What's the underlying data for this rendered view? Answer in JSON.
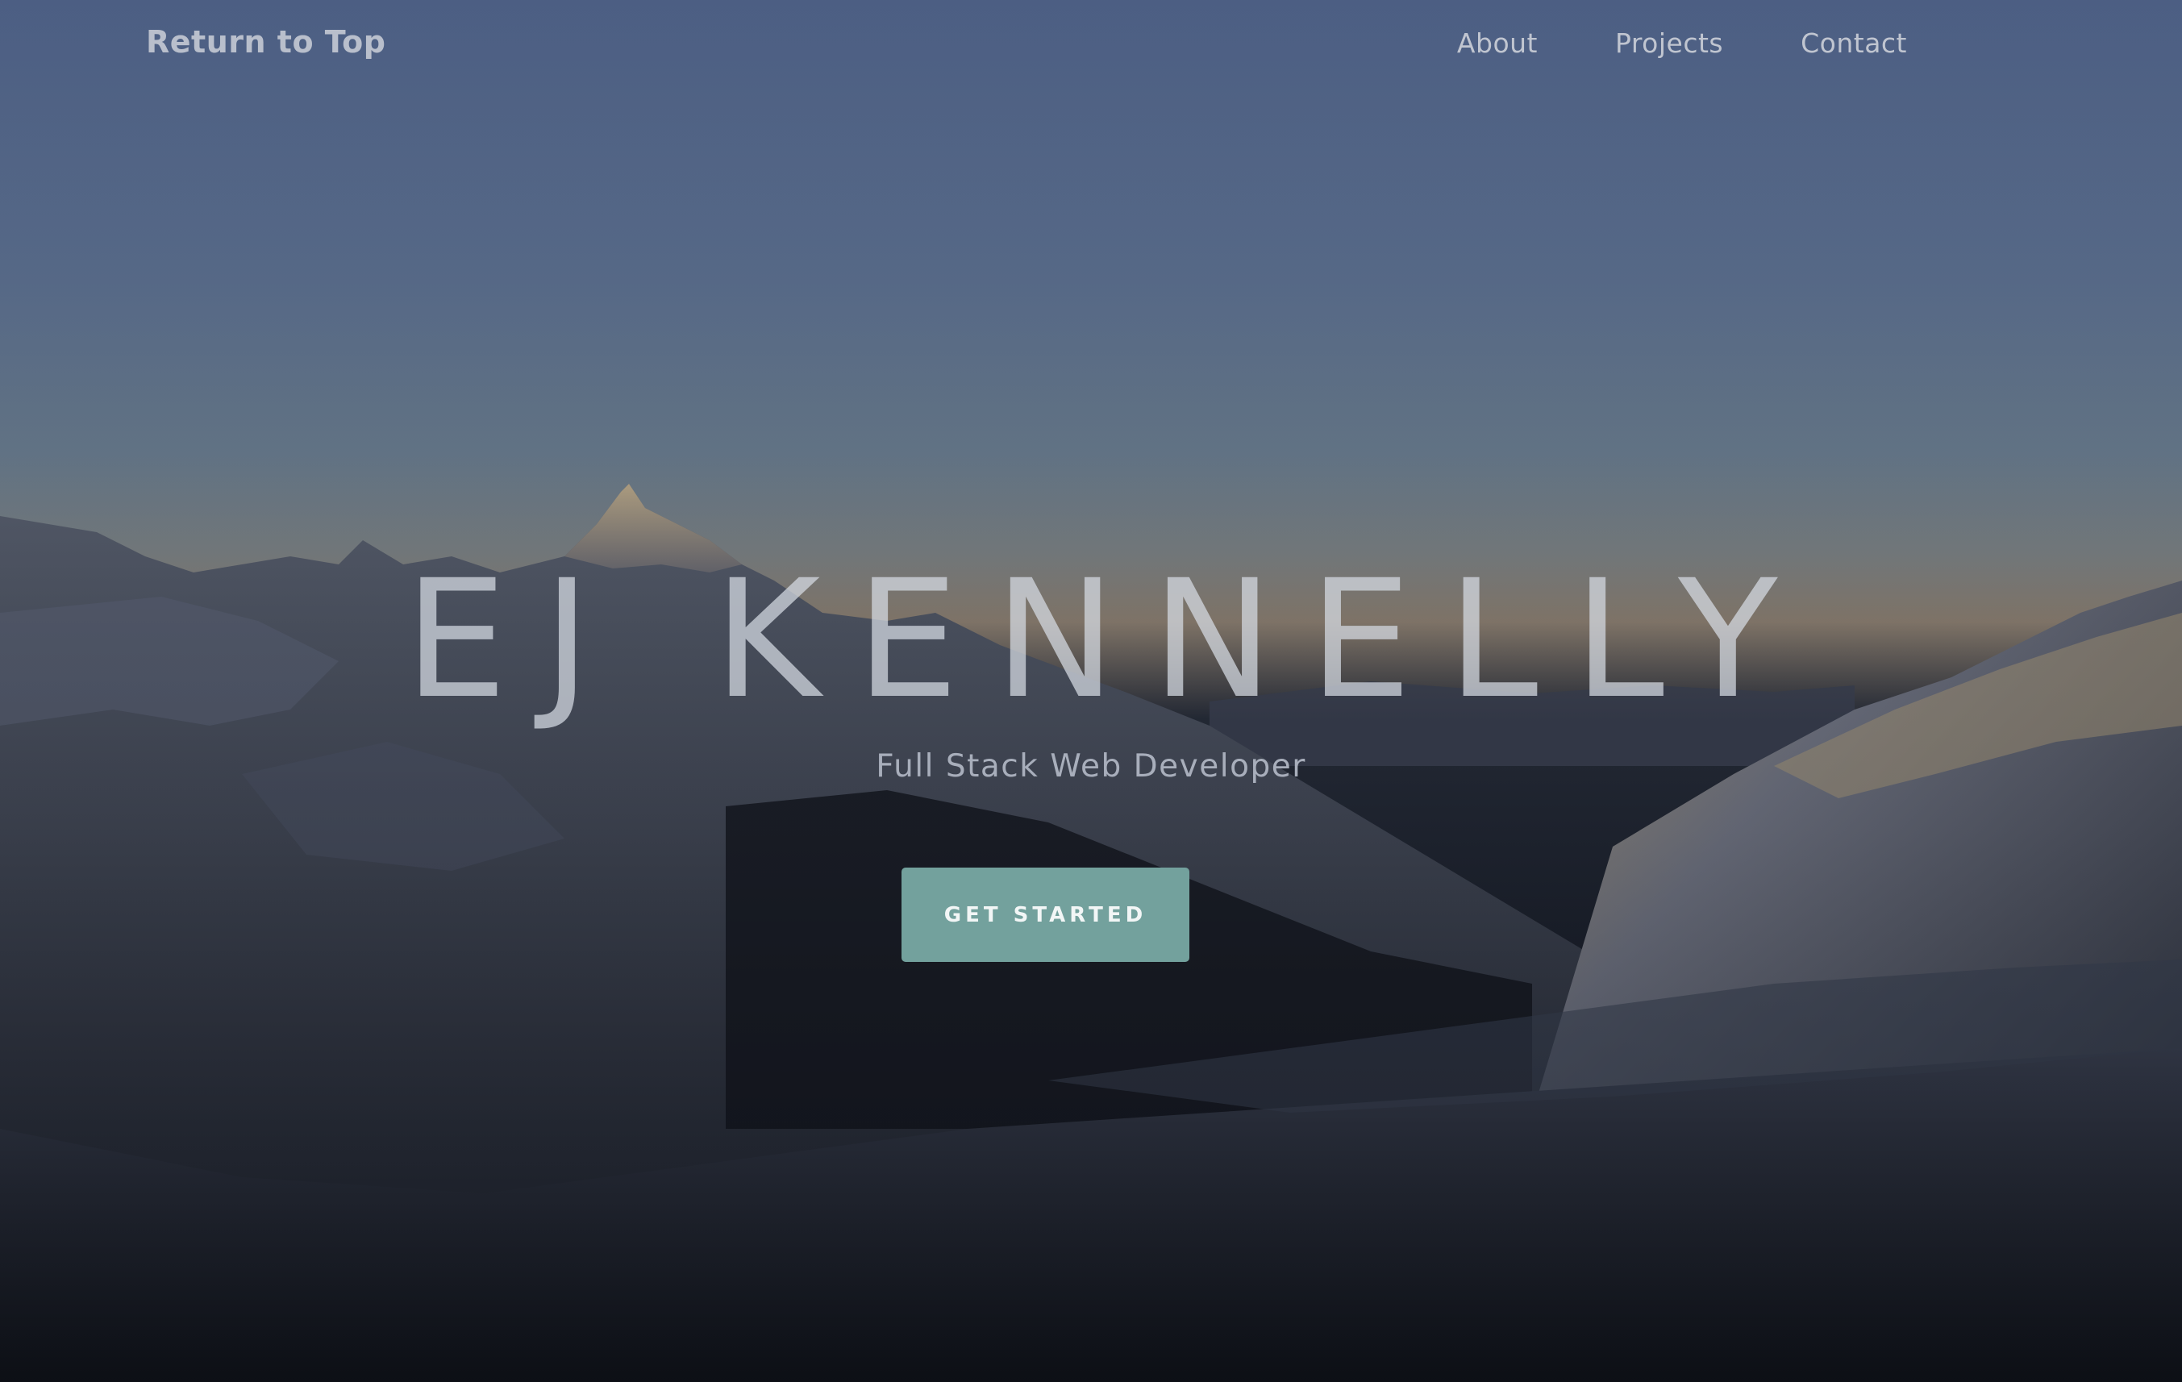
{
  "nav": {
    "brand": "Return to Top",
    "links": [
      {
        "label": "About"
      },
      {
        "label": "Projects"
      },
      {
        "label": "Contact"
      }
    ]
  },
  "hero": {
    "title": "EJ KENNELLY",
    "subtitle": "Full Stack Web Developer",
    "cta_label": "GET STARTED"
  },
  "colors": {
    "accent": "#73a19d",
    "sky_top": "#4f6288",
    "sky_horizon": "#8e8172"
  }
}
